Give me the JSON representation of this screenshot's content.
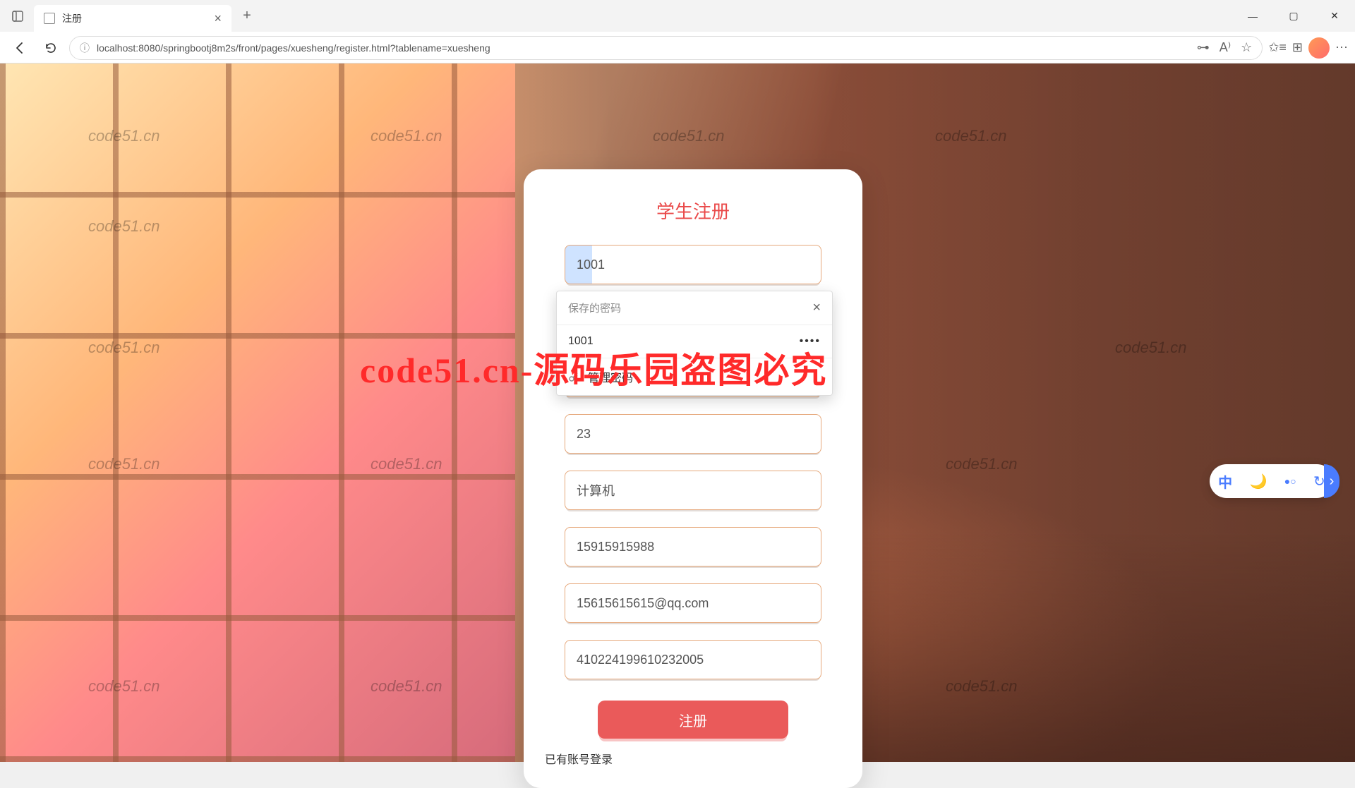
{
  "browser": {
    "tab_title": "注册",
    "url": "localhost:8080/springbootj8m2s/front/pages/xuesheng/register.html?tablename=xuesheng"
  },
  "watermark": {
    "short": "code51.cn",
    "banner": "code51.cn-源码乐园盗图必究"
  },
  "form": {
    "title": "学生注册",
    "fields": {
      "student_id": "1001",
      "age": "23",
      "major": "计算机",
      "phone": "15915915988",
      "email": "15615615615@qq.com",
      "id_card": "410224199610232005"
    },
    "submit_label": "注册",
    "login_link": "已有账号登录"
  },
  "password_popup": {
    "header": "保存的密码",
    "saved_user": "1001",
    "saved_mask": "••••",
    "manage_label": "管理密码"
  },
  "ime": {
    "lang": "中"
  }
}
